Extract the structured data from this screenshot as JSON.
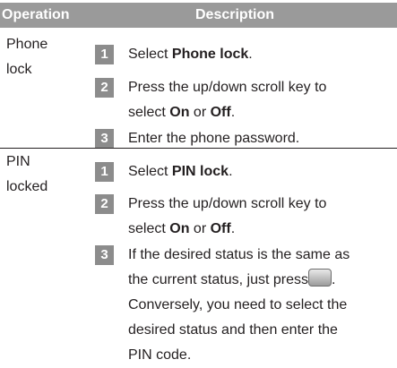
{
  "header": {
    "col_operation": "Operation",
    "col_description": "Description"
  },
  "rows": [
    {
      "operation_line1": "Phone",
      "operation_line2": "lock",
      "steps": [
        {
          "num": "1",
          "pre": "Select ",
          "bold": "Phone lock",
          "post": "."
        },
        {
          "num": "2",
          "line1": "Press the up/down scroll key to",
          "pre": "select ",
          "bold1": "On",
          "mid": " or ",
          "bold2": "Off",
          "post": "."
        },
        {
          "num": "3",
          "text": "Enter the phone password."
        }
      ]
    },
    {
      "operation_line1": "PIN",
      "operation_line2": "locked",
      "steps": [
        {
          "num": "1",
          "pre": "Select ",
          "bold": "PIN lock",
          "post": "."
        },
        {
          "num": "2",
          "line1": "Press the up/down scroll key to",
          "pre": "select ",
          "bold1": "On",
          "mid": " or ",
          "bold2": "Off",
          "post": "."
        },
        {
          "num": "3",
          "line1": "If the desired status is the same as",
          "line2_pre": "the current status, just press",
          "line2_post": ".",
          "line3": "Conversely, you need to select the",
          "line4": "desired status and then enter the",
          "line5": "PIN code.",
          "icon": "confirm-key-icon"
        }
      ]
    }
  ]
}
